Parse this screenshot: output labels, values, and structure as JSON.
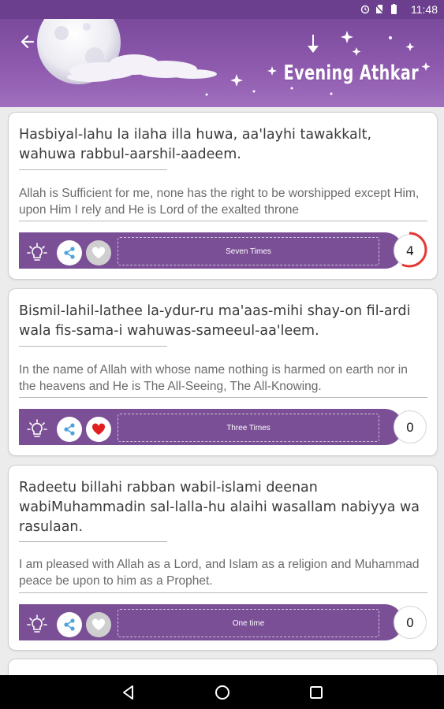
{
  "status_bar": {
    "time": "11:48",
    "icons": [
      "alarm-icon",
      "no-sim-icon",
      "battery-icon"
    ]
  },
  "header": {
    "title": "Evening Athkar"
  },
  "colors": {
    "accent": "#7a4f96",
    "header": "#8e5aae",
    "progress": "#e53935",
    "heart": "#e02020"
  },
  "cards": [
    {
      "arabic": "Hasbiyal-lahu la ilaha illa huwa, aa'layhi tawakkalt, wahuwa rabbul-aarshil-aadeem.",
      "translation": "Allah is Sufficient for me, none has the right to be worshipped except Him, upon Him I rely and He is Lord of the exalted throne",
      "repeat": "Seven Times",
      "count": "4",
      "favorite": false,
      "progress": 0.57
    },
    {
      "arabic": "Bismil-lahil-lathee la-ydur-ru ma'aas-mihi shay-on fil-ardi wala fis-sama-i wahuwas-sameeul-aa'leem.",
      "translation": "In the name of Allah with whose name nothing is harmed on earth nor in the heavens and He is The All-Seeing, The All-Knowing.",
      "repeat": "Three Times",
      "count": "0",
      "favorite": true,
      "progress": 0
    },
    {
      "arabic": "Radeetu billahi rabban wabil-islami deenan wabiMuhammadin sal-lalla-hu alaihi wasallam nabiyya wa rasulaan.",
      "translation": "I am pleased with Allah as a Lord, and Islam as a religion and Muhammad peace be upon to him as a Prophet.",
      "repeat": "One time",
      "count": "0",
      "favorite": false,
      "progress": 0
    }
  ]
}
